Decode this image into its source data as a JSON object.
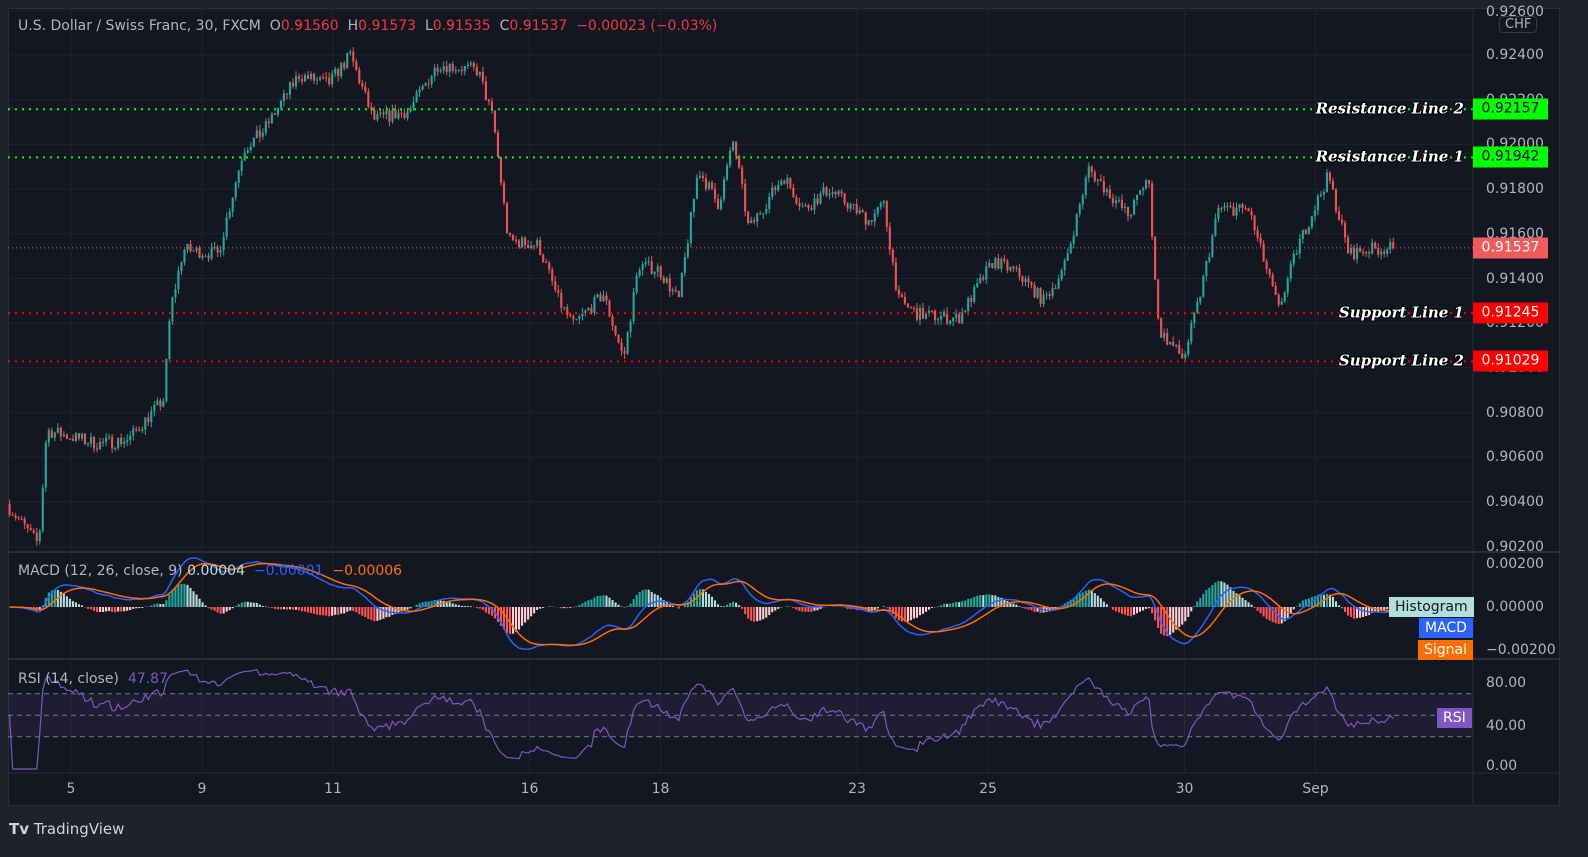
{
  "legend": {
    "symbol": "U.S. Dollar / Swiss Franc, 30, FXCM",
    "o_label": "O",
    "o": "0.91560",
    "h_label": "H",
    "h": "0.91573",
    "l_label": "L",
    "l": "0.91535",
    "c_label": "C",
    "c": "0.91537",
    "change": "−0.00023 (−0.03%)"
  },
  "currency": "CHF",
  "colors": {
    "up": "#26a69a",
    "down": "#ef5350",
    "resistance": "#00ff00",
    "support": "#ff0000",
    "macd": "#2962ff",
    "signal": "#ff6d00",
    "rsi": "#7e57c2",
    "last": "#f05b5b"
  },
  "macd_legend": {
    "title": "MACD (12, 26, close, 9)",
    "hist": "0.00004",
    "macd": "−0.00001",
    "signal": "−0.00006",
    "tags": {
      "histogram": "Histogram",
      "macd": "MACD",
      "signal": "Signal"
    }
  },
  "rsi_legend": {
    "title": "RSI (14, close)",
    "value": "47.87",
    "tag": "RSI"
  },
  "footer": {
    "brand": "TradingView"
  },
  "chart_data": {
    "type": "candlestick",
    "title": "U.S. Dollar / Swiss Franc, 30, FXCM",
    "ylabel": "CHF",
    "ylim": [
      0.902,
      0.926
    ],
    "price_ticks": [
      "0.92600",
      "0.92400",
      "0.92200",
      "0.92000",
      "0.91800",
      "0.91600",
      "0.91400",
      "0.91200",
      "0.91000",
      "0.90800",
      "0.90600",
      "0.90400",
      "0.90200"
    ],
    "price_tick_values": [
      0.926,
      0.924,
      0.922,
      0.92,
      0.918,
      0.916,
      0.914,
      0.912,
      0.91,
      0.908,
      0.906,
      0.904,
      0.902
    ],
    "x_unit": "trading days after label '5'",
    "x_ticks": [
      {
        "label": "5",
        "t": 0
      },
      {
        "label": "9",
        "t": 2
      },
      {
        "label": "11",
        "t": 4
      },
      {
        "label": "16",
        "t": 7
      },
      {
        "label": "18",
        "t": 9
      },
      {
        "label": "23",
        "t": 12
      },
      {
        "label": "25",
        "t": 14
      },
      {
        "label": "30",
        "t": 17
      },
      {
        "label": "Sep",
        "t": 19
      }
    ],
    "close_path": [
      [
        -0.96,
        0.9039
      ],
      [
        -0.47,
        0.9021
      ],
      [
        -0.35,
        0.9072
      ],
      [
        0.44,
        0.9066
      ],
      [
        0.9,
        0.9068
      ],
      [
        1.44,
        0.9086
      ],
      [
        1.54,
        0.9126
      ],
      [
        1.74,
        0.9153
      ],
      [
        2.27,
        0.9151
      ],
      [
        2.66,
        0.9198
      ],
      [
        2.96,
        0.9206
      ],
      [
        3.5,
        0.9231
      ],
      [
        3.95,
        0.9227
      ],
      [
        4.29,
        0.924
      ],
      [
        4.64,
        0.9211
      ],
      [
        5.18,
        0.9215
      ],
      [
        5.63,
        0.9236
      ],
      [
        6.24,
        0.9233
      ],
      [
        6.47,
        0.9211
      ],
      [
        6.7,
        0.9157
      ],
      [
        7.16,
        0.9155
      ],
      [
        7.47,
        0.913
      ],
      [
        7.69,
        0.9119
      ],
      [
        8.15,
        0.9133
      ],
      [
        8.46,
        0.9104
      ],
      [
        8.69,
        0.9146
      ],
      [
        9.0,
        0.9144
      ],
      [
        9.3,
        0.913
      ],
      [
        9.6,
        0.9189
      ],
      [
        9.91,
        0.9173
      ],
      [
        10.14,
        0.9202
      ],
      [
        10.37,
        0.9162
      ],
      [
        10.9,
        0.9186
      ],
      [
        11.21,
        0.9171
      ],
      [
        11.59,
        0.918
      ],
      [
        12.2,
        0.9166
      ],
      [
        12.43,
        0.9173
      ],
      [
        12.66,
        0.913
      ],
      [
        12.96,
        0.9124
      ],
      [
        13.57,
        0.9122
      ],
      [
        14.11,
        0.9148
      ],
      [
        14.49,
        0.9142
      ],
      [
        14.87,
        0.913
      ],
      [
        15.18,
        0.9144
      ],
      [
        15.56,
        0.9189
      ],
      [
        16.17,
        0.9168
      ],
      [
        16.47,
        0.9186
      ],
      [
        16.63,
        0.9117
      ],
      [
        17.01,
        0.9104
      ],
      [
        17.24,
        0.913
      ],
      [
        17.54,
        0.9171
      ],
      [
        18.0,
        0.9171
      ],
      [
        18.46,
        0.9126
      ],
      [
        18.76,
        0.9155
      ],
      [
        19.22,
        0.9186
      ],
      [
        19.53,
        0.9151
      ],
      [
        19.83,
        0.9153
      ],
      [
        20.21,
        0.91537
      ]
    ],
    "levels": [
      {
        "name": "Resistance Line 2",
        "value": 0.92157,
        "label": "0.92157",
        "kind": "resistance"
      },
      {
        "name": "Resistance Line 1",
        "value": 0.91942,
        "label": "0.91942",
        "kind": "resistance"
      },
      {
        "name": "Support Line 1",
        "value": 0.91245,
        "label": "0.91245",
        "kind": "support"
      },
      {
        "name": "Support Line 2",
        "value": 0.91029,
        "label": "0.91029",
        "kind": "support"
      }
    ],
    "last_price": {
      "value": 0.91537,
      "label": "0.91537"
    },
    "macd": {
      "params": [
        12,
        26,
        9
      ],
      "ylim": [
        -0.0025,
        0.0025
      ],
      "ticks": [
        "0.00200",
        "0.00000",
        "−0.00200"
      ],
      "tick_values": [
        0.002,
        0,
        -0.002
      ]
    },
    "rsi": {
      "period": 14,
      "ylim": [
        0,
        100
      ],
      "band": [
        30,
        70
      ],
      "mid": 50,
      "ticks": [
        "80.00",
        "40.00",
        "0.00"
      ],
      "tick_values": [
        80,
        40,
        0
      ]
    }
  }
}
